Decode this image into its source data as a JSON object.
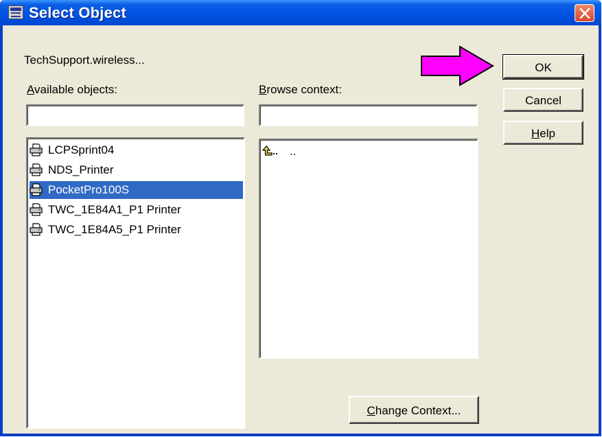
{
  "window": {
    "title": "Select Object",
    "icons": {
      "app": "app-window-icon",
      "close": "close-icon"
    }
  },
  "context_path": "TechSupport.wireless...",
  "available": {
    "label_hotkey": "A",
    "label_rest": "vailable objects:",
    "filter_value": "",
    "items": [
      {
        "label": "LCPSprint04",
        "icon": "printer-icon"
      },
      {
        "label": "NDS_Printer",
        "icon": "printer-icon"
      },
      {
        "label": "PocketPro100S",
        "icon": "printer-icon",
        "selected": true
      },
      {
        "label": "TWC_1E84A1_P1 Printer",
        "icon": "printer-icon"
      },
      {
        "label": "TWC_1E84A5_P1 Printer",
        "icon": "printer-icon"
      }
    ]
  },
  "browse": {
    "label_hotkey": "B",
    "label_rest": "rowse context:",
    "filter_value": "",
    "items": [
      {
        "label": "..",
        "icon": "parent-folder-icon"
      }
    ]
  },
  "buttons": {
    "ok": "OK",
    "cancel": "Cancel",
    "help_hotkey": "H",
    "help_rest": "elp",
    "change_hotkey": "C",
    "change_rest": "hange Context..."
  },
  "annotation": {
    "icon": "arrow-right-icon",
    "color": "#ff00ff"
  },
  "colors": {
    "titlebar": "#0054e3",
    "selection": "#316ac5",
    "dialog": "#ece9d8",
    "close": "#d8462a"
  }
}
